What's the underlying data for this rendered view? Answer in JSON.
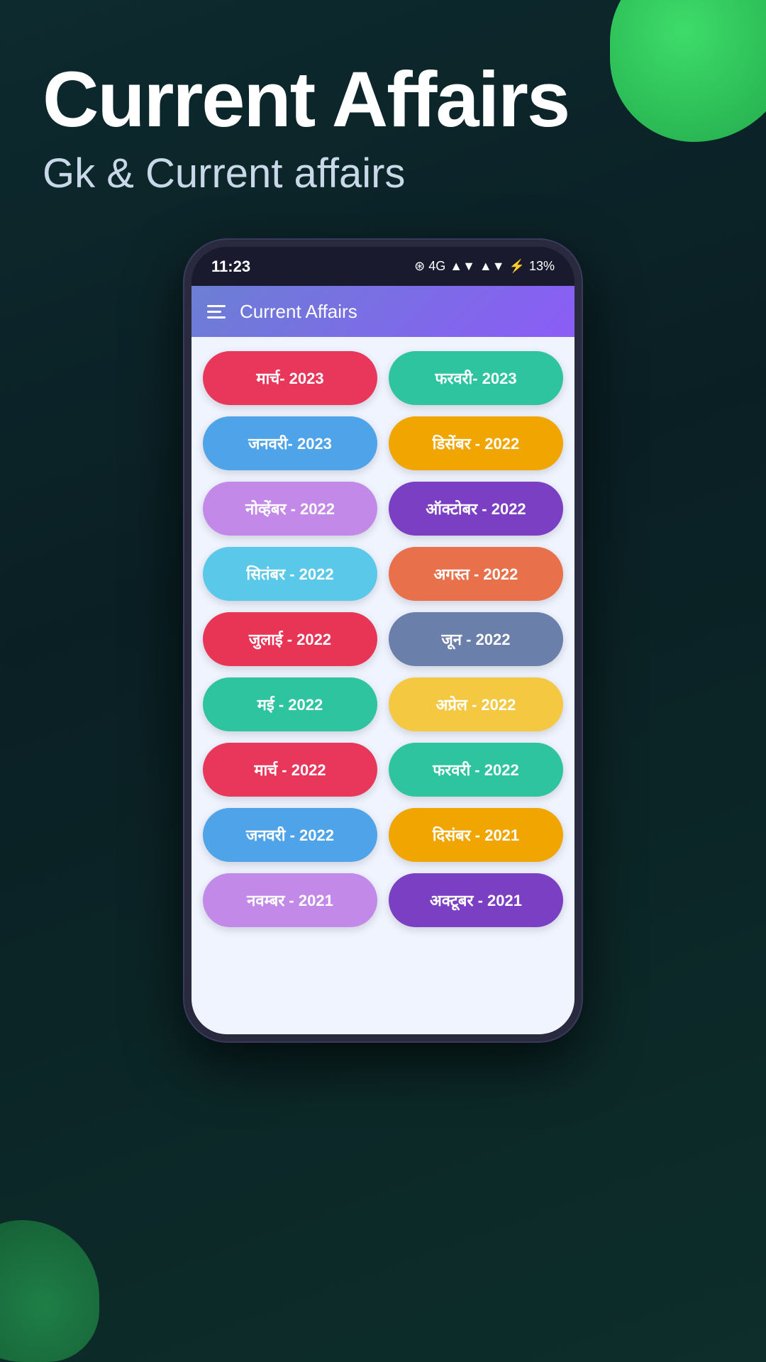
{
  "background": {
    "color": "#0d2a2e"
  },
  "hero": {
    "title": "Current Affairs",
    "subtitle": "Gk & Current affairs"
  },
  "status_bar": {
    "time": "11:23",
    "indicators": "⊛ 4G ▲▼ ▲▼ ⚡ 13%"
  },
  "app_bar": {
    "title": "Current Affairs"
  },
  "month_buttons": [
    {
      "label": "मार्च- 2023",
      "color_class": "btn-pink"
    },
    {
      "label": "फरवरी- 2023",
      "color_class": "btn-teal"
    },
    {
      "label": "जनवरी- 2023",
      "color_class": "btn-blue"
    },
    {
      "label": "डिसेंबर - 2022",
      "color_class": "btn-yellow"
    },
    {
      "label": "नोव्हेंबर - 2022",
      "color_class": "btn-lavender"
    },
    {
      "label": "ऑक्टोबर - 2022",
      "color_class": "btn-purple"
    },
    {
      "label": "सितंबर - 2022",
      "color_class": "btn-lightblue"
    },
    {
      "label": "अगस्त - 2022",
      "color_class": "btn-orange"
    },
    {
      "label": "जुलाई - 2022",
      "color_class": "btn-crimson"
    },
    {
      "label": "जून - 2022",
      "color_class": "btn-slate"
    },
    {
      "label": "मई - 2022",
      "color_class": "btn-green"
    },
    {
      "label": "अप्रेल - 2022",
      "color_class": "btn-amber"
    },
    {
      "label": "मार्च - 2022",
      "color_class": "btn-pink2"
    },
    {
      "label": "फरवरी - 2022",
      "color_class": "btn-teal2"
    },
    {
      "label": "जनवरी - 2022",
      "color_class": "btn-skyblue"
    },
    {
      "label": "दिसंबर - 2021",
      "color_class": "btn-golden"
    },
    {
      "label": "नवम्बर - 2021",
      "color_class": "btn-violet"
    },
    {
      "label": "अक्टूबर - 2021",
      "color_class": "btn-darkpurple"
    }
  ]
}
